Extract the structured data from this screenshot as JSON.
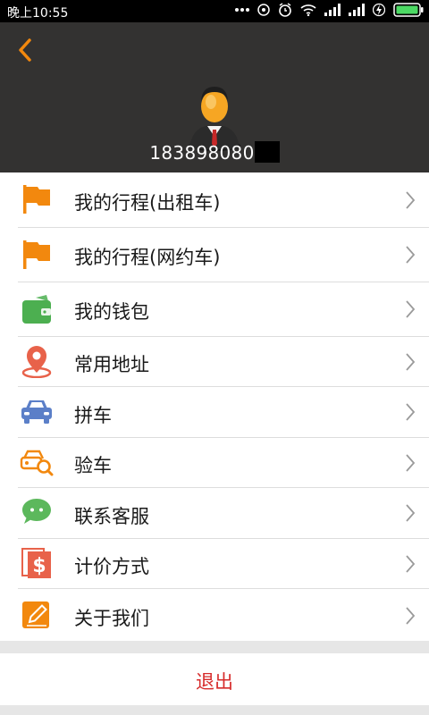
{
  "status_bar": {
    "time": "晚上10:55"
  },
  "profile": {
    "phone": "183898080"
  },
  "menu": [
    {
      "label": "我的行程(出租车)",
      "icon": "flag-icon",
      "color": "#f2880e"
    },
    {
      "label": "我的行程(网约车)",
      "icon": "flag-icon",
      "color": "#f2880e"
    },
    {
      "label": "我的钱包",
      "icon": "wallet-icon",
      "color": "#4caf50"
    },
    {
      "label": "常用地址",
      "icon": "location-pin-icon",
      "color": "#e8624a"
    },
    {
      "label": "拼车",
      "icon": "car-icon",
      "color": "#5b7fc8"
    },
    {
      "label": "验车",
      "icon": "car-inspect-icon",
      "color": "#f2880e"
    },
    {
      "label": "联系客服",
      "icon": "chat-bubble-icon",
      "color": "#5cb85c"
    },
    {
      "label": "计价方式",
      "icon": "dollar-icon",
      "color": "#e8624a"
    },
    {
      "label": "关于我们",
      "icon": "edit-pencil-icon",
      "color": "#f2880e"
    }
  ],
  "logout": {
    "label": "退出",
    "color": "#d62b2b"
  },
  "colors": {
    "accent": "#f2880e",
    "header_bg": "#333231"
  }
}
